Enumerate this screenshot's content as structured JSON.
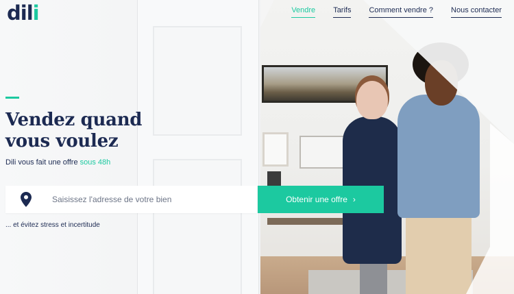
{
  "logo": {
    "text_main": "dil",
    "text_accent": "i"
  },
  "nav": {
    "items": [
      {
        "label": "Vendre",
        "active": true
      },
      {
        "label": "Tarifs",
        "active": false
      },
      {
        "label": "Comment vendre ?",
        "active": false
      },
      {
        "label": "Nous contacter",
        "active": false
      }
    ]
  },
  "hero": {
    "headline_line1": "Vendez quand",
    "headline_line2": "vous voulez",
    "subline_text": "Dili vous fait une offre",
    "subline_highlight": "sous 48h",
    "tagline": "... et évitez stress et incertitude"
  },
  "search": {
    "placeholder": "Saisissez l'adresse de votre bien",
    "value": "",
    "icon": "location-pin-icon"
  },
  "cta": {
    "label": "Obtenir une offre",
    "icon": "chevron-right-icon"
  },
  "colors": {
    "brand": "#1c2a52",
    "accent": "#1cc9a0"
  }
}
